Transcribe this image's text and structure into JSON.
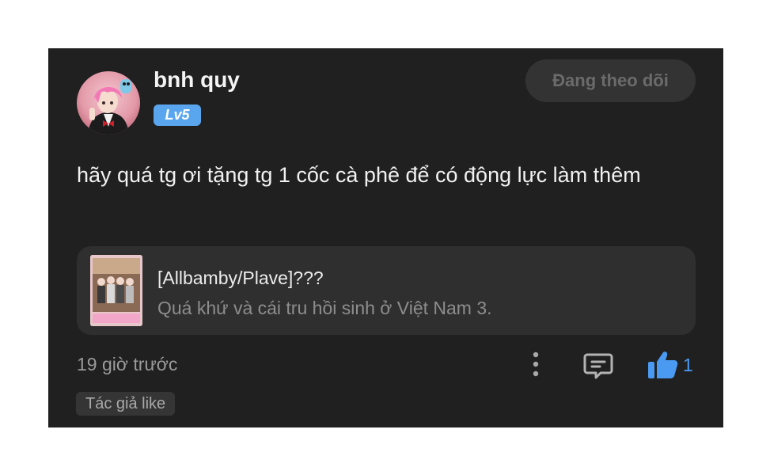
{
  "comment": {
    "username": "bnh quy",
    "level_badge": "Lv5",
    "follow_button": "Đang theo dõi",
    "text": "hãy quá tg ơi tặng tg 1 cốc cà phê để có động lực làm thêm",
    "story": {
      "title": "[Allbamby/Plave]???",
      "subtitle": "Quá khứ và cái tru hồi sinh ở Việt Nam 3."
    },
    "time_ago": "19 giờ trước",
    "like_count": "1",
    "author_like_tag": "Tác giả like"
  },
  "colors": {
    "card_background": "#202020",
    "level_badge": "#5aa6ee",
    "like_accent": "#4a9af2"
  },
  "icons": [
    "more-vertical-icon",
    "reply-comment-icon",
    "thumbs-up-icon"
  ]
}
